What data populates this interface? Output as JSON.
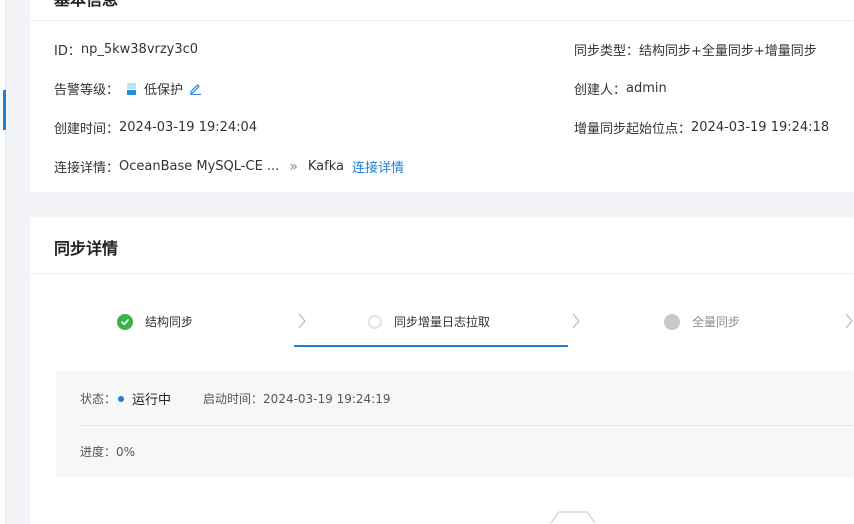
{
  "basic": {
    "title": "基本信息",
    "id_label": "ID：",
    "id_value": "np_5kw38vrzy3c0",
    "sync_type_label": "同步类型：",
    "sync_type_value": "结构同步+全量同步+增量同步",
    "alarm_label": "告警等级：",
    "alarm_value": "低保护",
    "creator_label": "创建人：",
    "creator_value": "admin",
    "create_time_label": "创建时间：",
    "create_time_value": "2024-03-19 19:24:04",
    "incr_start_label": "增量同步起始位点：",
    "incr_start_value": "2024-03-19 19:24:18",
    "conn_label": "连接详情：",
    "conn_source": "OceanBase MySQL-CE ...",
    "conn_arrow": "»",
    "conn_target": "Kafka",
    "conn_link": "连接详情"
  },
  "sync": {
    "title": "同步详情",
    "steps": [
      {
        "label": "结构同步",
        "state": "done"
      },
      {
        "label": "同步增量日志拉取",
        "state": "active"
      },
      {
        "label": "全量同步",
        "state": "wait"
      }
    ],
    "status_label": "状态：",
    "status_value": "运行中",
    "start_time_label": "启动时间：",
    "start_time_value": "2024-03-19 19:24:19",
    "progress_label": "进度：",
    "progress_value": "0%"
  },
  "colors": {
    "accent": "#1f7fd8",
    "success": "#3bb34a",
    "wait": "#c8c8c8"
  },
  "icons": {
    "edit": "edit-icon",
    "check": "check-icon",
    "chevron": "chevron-right-icon"
  }
}
